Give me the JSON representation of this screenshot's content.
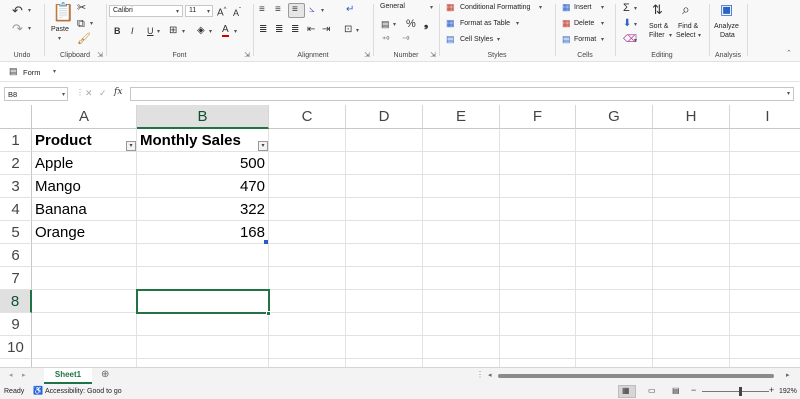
{
  "ribbon": {
    "undo": {
      "label": "Undo"
    },
    "clipboard": {
      "label": "Clipboard",
      "paste": "Paste"
    },
    "font": {
      "label": "Font",
      "name": "Calibri",
      "size": "11",
      "bold": "B",
      "italic": "I",
      "underline": "U"
    },
    "alignment": {
      "label": "Alignment"
    },
    "number": {
      "label": "Number",
      "format": "General"
    },
    "styles": {
      "label": "Styles",
      "conditional": "Conditional Formatting",
      "format_table": "Format as Table",
      "cell_styles": "Cell Styles"
    },
    "cells": {
      "label": "Cells",
      "insert": "Insert",
      "delete": "Delete",
      "format": "Format"
    },
    "editing": {
      "label": "Editing",
      "sort1": "Sort &",
      "sort2": "Filter",
      "find1": "Find &",
      "find2": "Select"
    },
    "analysis": {
      "label": "Analysis",
      "analyze1": "Analyze",
      "analyze2": "Data"
    }
  },
  "formbar": {
    "form_label": "Form"
  },
  "formula": {
    "namebox": "B8",
    "fx": "fx",
    "value": ""
  },
  "columns": [
    "A",
    "B",
    "C",
    "D",
    "E",
    "F",
    "G",
    "H",
    "I"
  ],
  "rows": [
    "1",
    "2",
    "3",
    "4",
    "5",
    "6",
    "7",
    "8",
    "9",
    "10"
  ],
  "table": {
    "headers": [
      "Product",
      "Monthly Sales"
    ],
    "rows": [
      [
        "Apple",
        "500"
      ],
      [
        "Mango",
        "470"
      ],
      [
        "Banana",
        "322"
      ],
      [
        "Orange",
        "168"
      ]
    ]
  },
  "selected_cell": "B8",
  "sheets": [
    {
      "name": "Sheet1",
      "active": true
    }
  ],
  "status": {
    "ready": "Ready",
    "accessibility": "Accessibility: Good to go",
    "zoom": "192%"
  },
  "colors": {
    "accent": "#217346",
    "fill_handle": "#2e58c9"
  }
}
